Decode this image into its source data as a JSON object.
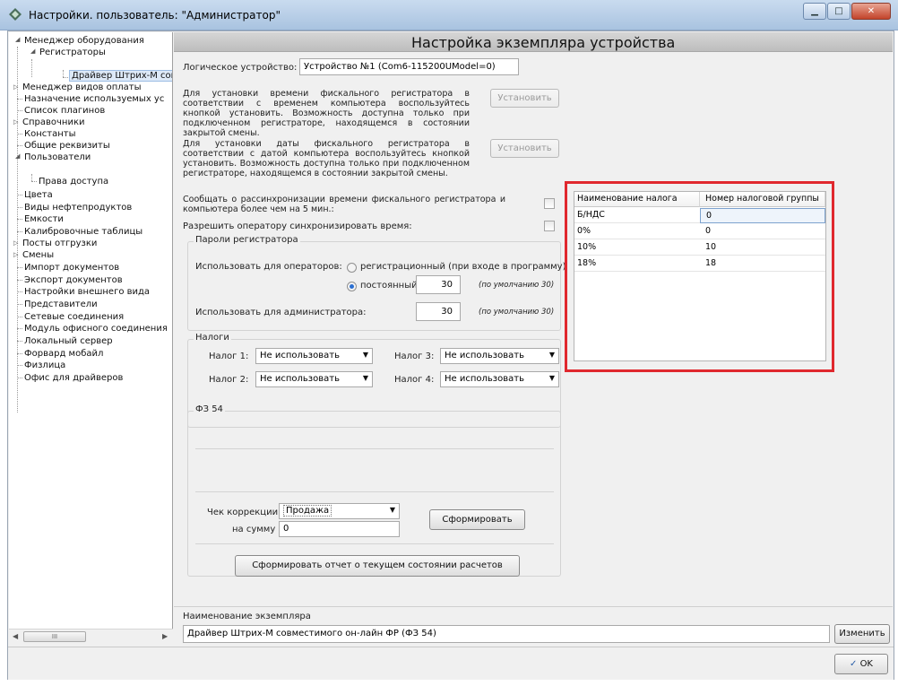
{
  "window": {
    "title": "Настройки. пользователь: \"Администратор\""
  },
  "tree": {
    "items": [
      {
        "label": "Менеджер оборудования"
      },
      {
        "label": "Регистраторы"
      },
      {
        "label": "Драйвер Штрих-М сов"
      },
      {
        "label": "Менеджер видов оплаты"
      },
      {
        "label": "Назначение используемых ус"
      },
      {
        "label": "Список плагинов"
      },
      {
        "label": "Справочники"
      },
      {
        "label": "Константы"
      },
      {
        "label": "Общие реквизиты"
      },
      {
        "label": "Пользователи"
      },
      {
        "label": "Права доступа"
      },
      {
        "label": "Цвета"
      },
      {
        "label": "Виды нефтепродуктов"
      },
      {
        "label": "Емкости"
      },
      {
        "label": "Калибровочные таблицы"
      },
      {
        "label": "Посты отгрузки"
      },
      {
        "label": "Смены"
      },
      {
        "label": "Импорт документов"
      },
      {
        "label": "Экспорт документов"
      },
      {
        "label": "Настройки внешнего вида"
      },
      {
        "label": "Представители"
      },
      {
        "label": "Сетевые соединения"
      },
      {
        "label": "Модуль офисного соединения"
      },
      {
        "label": "Локальный сервер"
      },
      {
        "label": "Форвард мобайл"
      },
      {
        "label": "Физлица"
      },
      {
        "label": "Офис для драйверов"
      }
    ],
    "scroll_thumb": "III"
  },
  "main": {
    "title": "Настройка экземпляра устройства",
    "logical_device_label": "Логическое устройство:",
    "logical_device_value": "Устройство №1 (Com6-115200UModel=0)",
    "time_text": "Для установки времени фискального регистратора в соответствии с временем компьютера воспользуйтесь кнопкой установить. Возможность доступна только при подключенном регистраторе, находящемся в состоянии закрытой смены.",
    "date_text": "Для установки даты фискального регистратора в соответствии с датой компьютера воспользуйтесь кнопкой установить. Возможность доступна только при подключенном регистраторе, находящемся в состоянии закрытой смены.",
    "set_button": "Установить",
    "desync_text": "Сообщать о рассинхронизации времени фискального регистратора и компьютера более чем на 5 мин.:",
    "allow_sync_text": "Разрешить оператору синхронизировать время:",
    "passwords_group": "Пароли регистратора",
    "use_for_operators": "Использовать для операторов:",
    "radio_registration": "регистрационный (при входе в программу)",
    "radio_permanent": "постоянный:",
    "operator_password": "30",
    "default_hint": "(по умолчанию 30)",
    "use_for_admin": "Использовать для администратора:",
    "admin_password": "30",
    "taxes_group": "Налоги",
    "tax1_label": "Налог 1:",
    "tax2_label": "Налог 2:",
    "tax3_label": "Налог 3:",
    "tax4_label": "Налог 4:",
    "tax_option": "Не использовать",
    "fz54_group": "ФЗ 54",
    "correction_label": "Чек коррекции",
    "correction_value": "Продажа",
    "amount_label": "на сумму",
    "amount_value": "0",
    "form_button": "Сформировать",
    "report_button": "Сформировать отчет о текущем состоянии расчетов"
  },
  "tax_table": {
    "headers": [
      "Наименование налога",
      "Номер налоговой группы"
    ],
    "rows": [
      [
        "Б/НДС",
        "0"
      ],
      [
        "0%",
        "0"
      ],
      [
        "10%",
        "10"
      ],
      [
        "18%",
        "18"
      ]
    ],
    "highlight_color": "#e0282e"
  },
  "instance": {
    "label": "Наименование экземпляра",
    "value": "Драйвер Штрих-М совместимого он-лайн ФР (ФЗ 54)",
    "change_button": "Изменить"
  },
  "footer": {
    "ok_button": "OK"
  }
}
